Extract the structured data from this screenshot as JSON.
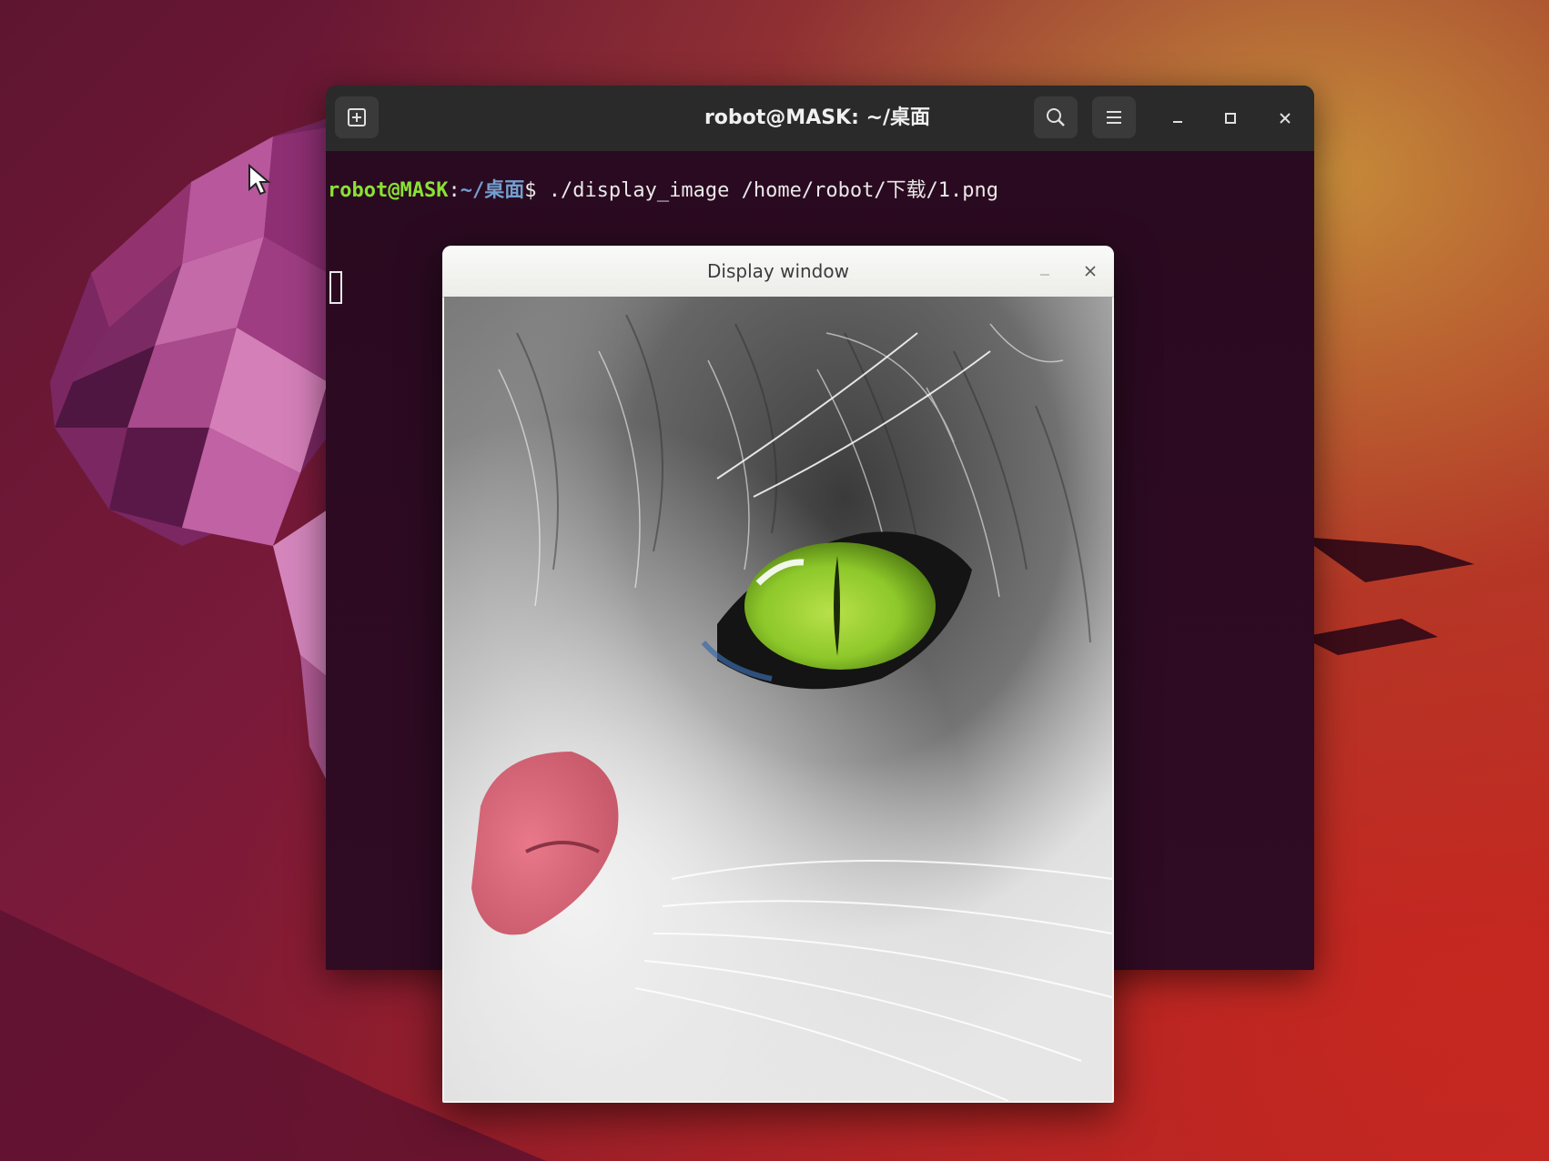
{
  "terminal": {
    "title": "robot@MASK: ~/桌面",
    "prompt_user_host": "robot@MASK",
    "prompt_separator": ":",
    "prompt_path": "~/桌面",
    "prompt_symbol": "$ ",
    "command": "./display_image /home/robot/下载/1.png",
    "icons": {
      "new_tab": "new-tab-icon",
      "search": "search-icon",
      "menu": "hamburger-menu-icon",
      "minimize": "minimize-icon",
      "maximize": "maximize-icon",
      "close": "close-icon"
    }
  },
  "display_window": {
    "title": "Display window",
    "image_subject": "cat-eye-closeup",
    "icons": {
      "minimize": "minimize-icon",
      "close": "close-icon"
    }
  },
  "colors": {
    "prompt_user": "#8ae234",
    "prompt_path": "#729fcf",
    "terminal_bg": "#300b24",
    "cat_eye": "#8dc82a"
  }
}
